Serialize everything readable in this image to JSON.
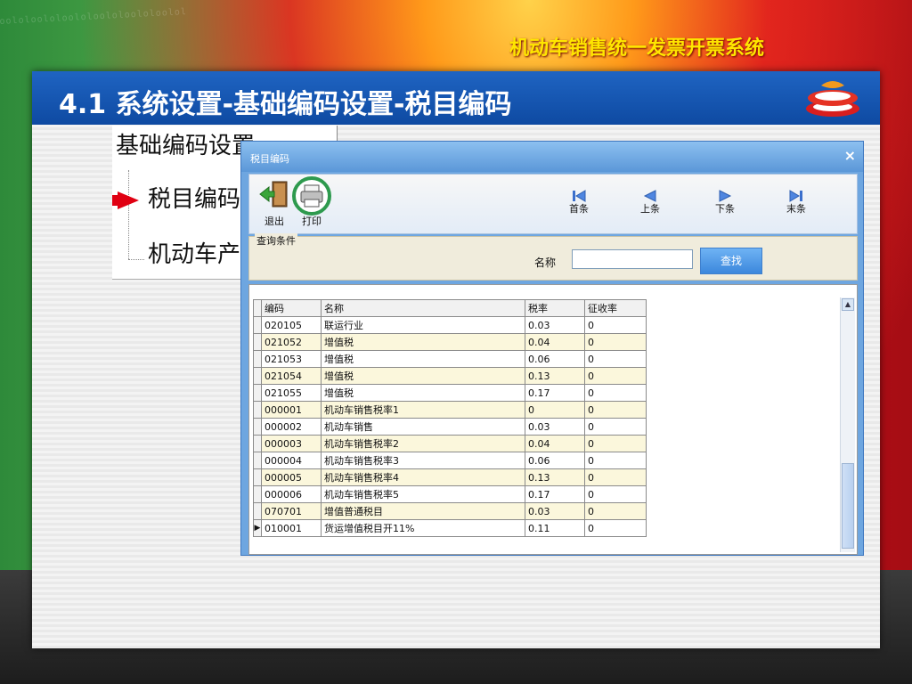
{
  "header": {
    "system_title": "机动车销售统一发票开票系统",
    "pattern_text": "oololoololoololoololoololoolol"
  },
  "slide": {
    "title": "4.1 系统设置-基础编码设置-税目编码"
  },
  "tree": {
    "root": "基础编码设置",
    "selected": "税目编码",
    "next": "机动车产品"
  },
  "window": {
    "title": "税目编码",
    "close": "×"
  },
  "toolbar": {
    "exit": "退出",
    "print": "打印",
    "first": "首条",
    "prev": "上条",
    "next": "下条",
    "last": "末条"
  },
  "query": {
    "group_title": "查询条件",
    "name_label": "名称",
    "name_value": "",
    "search_button": "查找"
  },
  "table": {
    "columns": [
      "编码",
      "名称",
      "税率",
      "征收率"
    ],
    "rows": [
      [
        "020105",
        "联运行业",
        "0.03",
        "0"
      ],
      [
        "021052",
        "增值税",
        "0.04",
        "0"
      ],
      [
        "021053",
        "增值税",
        "0.06",
        "0"
      ],
      [
        "021054",
        "增值税",
        "0.13",
        "0"
      ],
      [
        "021055",
        "增值税",
        "0.17",
        "0"
      ],
      [
        "000001",
        "机动车销售税率1",
        "0",
        "0"
      ],
      [
        "000002",
        "机动车销售",
        "0.03",
        "0"
      ],
      [
        "000003",
        "机动车销售税率2",
        "0.04",
        "0"
      ],
      [
        "000004",
        "机动车销售税率3",
        "0.06",
        "0"
      ],
      [
        "000005",
        "机动车销售税率4",
        "0.13",
        "0"
      ],
      [
        "000006",
        "机动车销售税率5",
        "0.17",
        "0"
      ],
      [
        "070701",
        "增值普通税目",
        "0.03",
        "0"
      ],
      [
        "010001",
        "货运增值税目开11%",
        "0.11",
        "0"
      ]
    ],
    "current_row": 12
  },
  "icons": {
    "exit": "exit-door-icon",
    "print": "printer-icon",
    "first": "first-record-icon",
    "prev": "previous-record-icon",
    "next": "next-record-icon",
    "last": "last-record-icon",
    "logo": "logo-icon"
  },
  "colors": {
    "header_title": "#ffe600",
    "slide_title_bar": "#1565c0",
    "tree_arrow": "#e00012",
    "print_highlight": "#2e9a4e",
    "window_blue": "#6ea6e0"
  }
}
